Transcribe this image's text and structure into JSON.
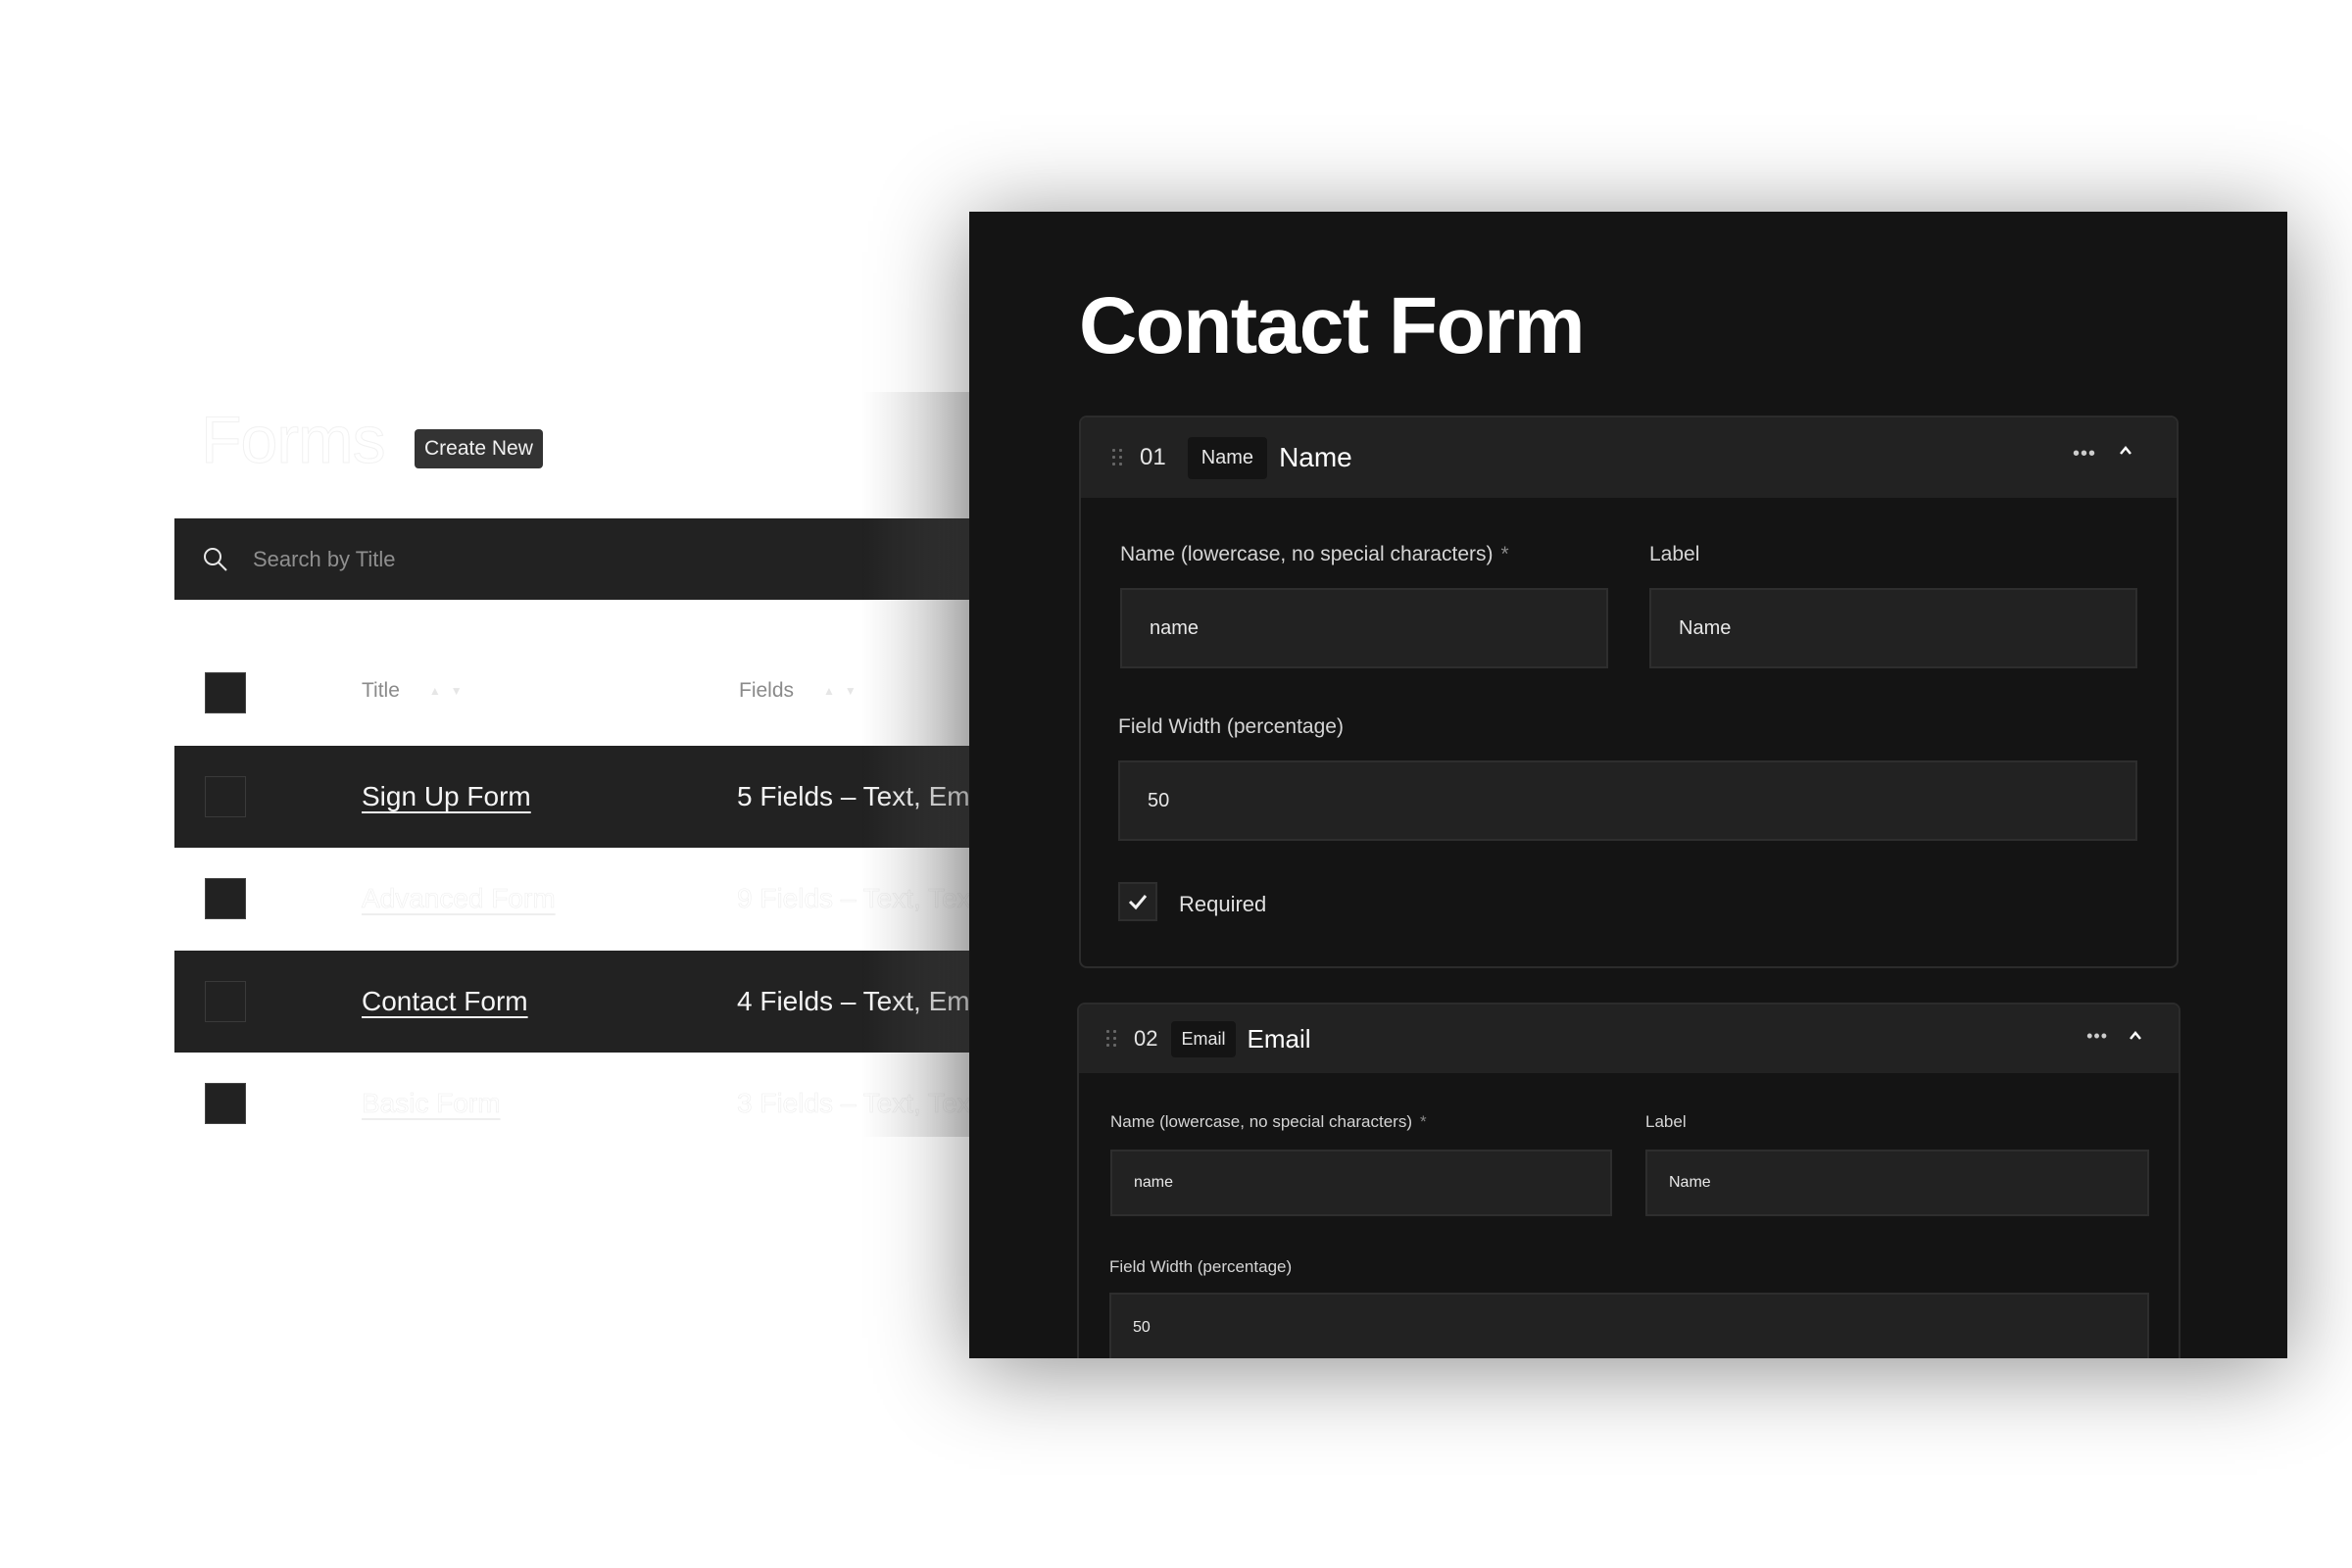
{
  "list": {
    "title": "Forms",
    "create_button": "Create New",
    "search": {
      "placeholder": "Search by Title",
      "value": ""
    },
    "columns": [
      {
        "label": "Title"
      },
      {
        "label": "Fields"
      }
    ],
    "rows": [
      {
        "title": "Sign Up Form",
        "fields": "5 Fields – Text, Em",
        "highlighted": true
      },
      {
        "title": "Advanced Form",
        "fields": "9 Fields – Text, Tex",
        "highlighted": false
      },
      {
        "title": "Contact Form",
        "fields": "4 Fields – Text, Em",
        "highlighted": true
      },
      {
        "title": "Basic Form",
        "fields": "3 Fields – Text, Tex",
        "highlighted": false
      }
    ]
  },
  "editor": {
    "title": "Contact Form",
    "fields": [
      {
        "number": "01",
        "type": "Name",
        "label_display": "Name",
        "name_label": "Name (lowercase, no special characters)",
        "required_marker": "*",
        "name_value": "name",
        "label_label": "Label",
        "label_value": "Name",
        "width_label": "Field Width (percentage)",
        "width_value": "50",
        "required_label": "Required",
        "required_checked": true,
        "more_icon": "ellipsis-icon",
        "collapse_icon": "chevron-up-icon"
      },
      {
        "number": "02",
        "type": "Email",
        "label_display": "Email",
        "name_label": "Name (lowercase, no special characters)",
        "required_marker": "*",
        "name_value": "name",
        "label_label": "Label",
        "label_value": "Name",
        "width_label": "Field Width (percentage)",
        "width_value": "50",
        "more_icon": "ellipsis-icon",
        "collapse_icon": "chevron-up-icon"
      }
    ]
  },
  "colors": {
    "panel_bg": "#141414",
    "surface": "#222222",
    "border": "#2e2e2e",
    "text": "#ffffff",
    "muted": "#8a8a8a"
  }
}
